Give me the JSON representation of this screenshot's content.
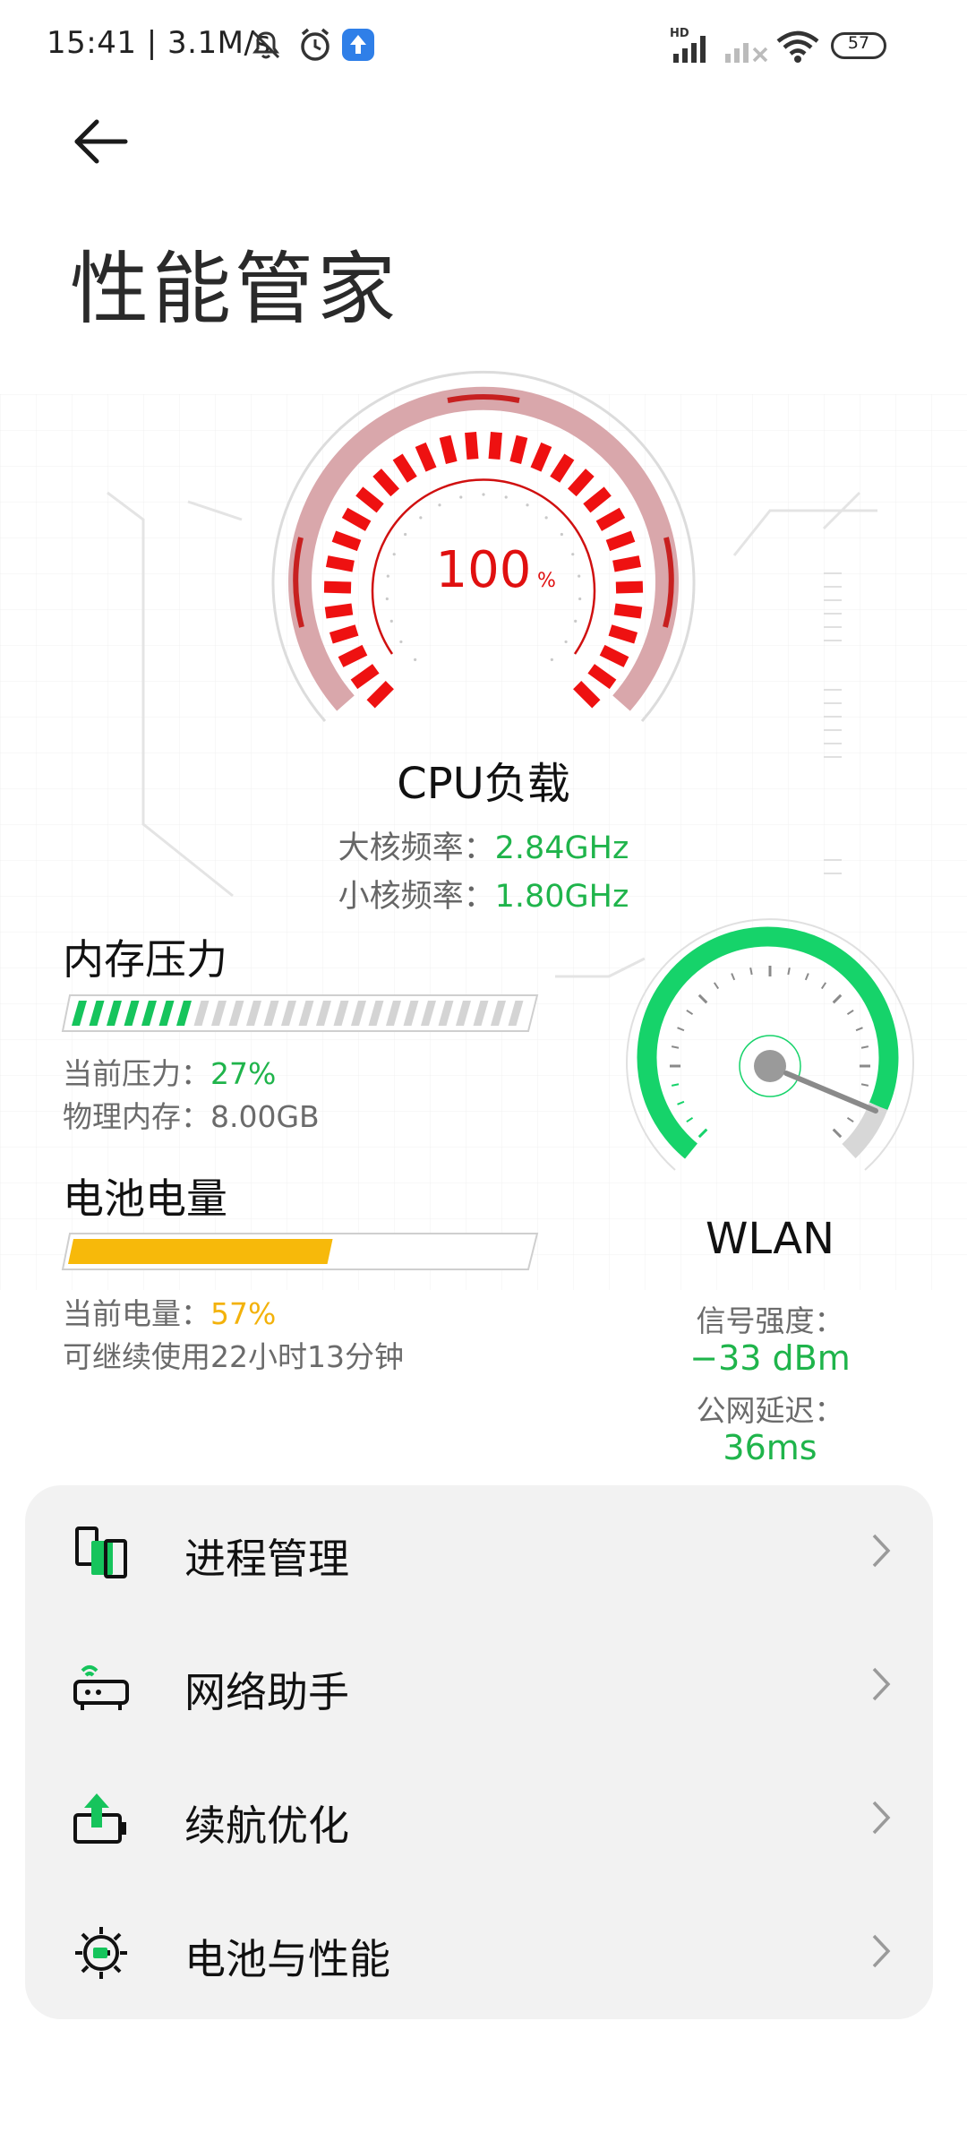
{
  "status_bar": {
    "time": "15:41 | 3.1M/s",
    "battery": "57",
    "network_badge": "HD"
  },
  "header": {
    "title": "性能管家"
  },
  "cpu": {
    "percent": "100",
    "percent_unit": "%",
    "label": "CPU负载",
    "big_core_label": "大核频率：",
    "big_core_value": "2.84GHz",
    "little_core_label": "小核频率：",
    "little_core_value": "1.80GHz",
    "load_fraction": 1.0
  },
  "memory": {
    "title": "内存压力",
    "pressure_label": "当前压力：",
    "pressure_value": "27%",
    "pressure_fraction": 0.27,
    "physical_label": "物理内存：",
    "physical_value": "8.00GB"
  },
  "battery": {
    "title": "电池电量",
    "level_label": "当前电量：",
    "level_value": "57%",
    "level_fraction": 0.57,
    "remaining": "可继续使用22小时13分钟"
  },
  "wlan": {
    "title": "WLAN",
    "signal_label": "信号强度：",
    "signal_value": "−33 dBm",
    "latency_label": "公网延迟：",
    "latency_value": "36ms"
  },
  "menu": {
    "items": [
      {
        "label": "进程管理",
        "icon": "process-icon"
      },
      {
        "label": "网络助手",
        "icon": "router-icon"
      },
      {
        "label": "续航优化",
        "icon": "battery-boost-icon"
      },
      {
        "label": "电池与性能",
        "icon": "gear-icon"
      }
    ]
  },
  "colors": {
    "accent_green": "#1fb44b",
    "gauge_red": "#e01010",
    "battery_yellow": "#f3b20b",
    "wlan_green": "#16d36a"
  }
}
